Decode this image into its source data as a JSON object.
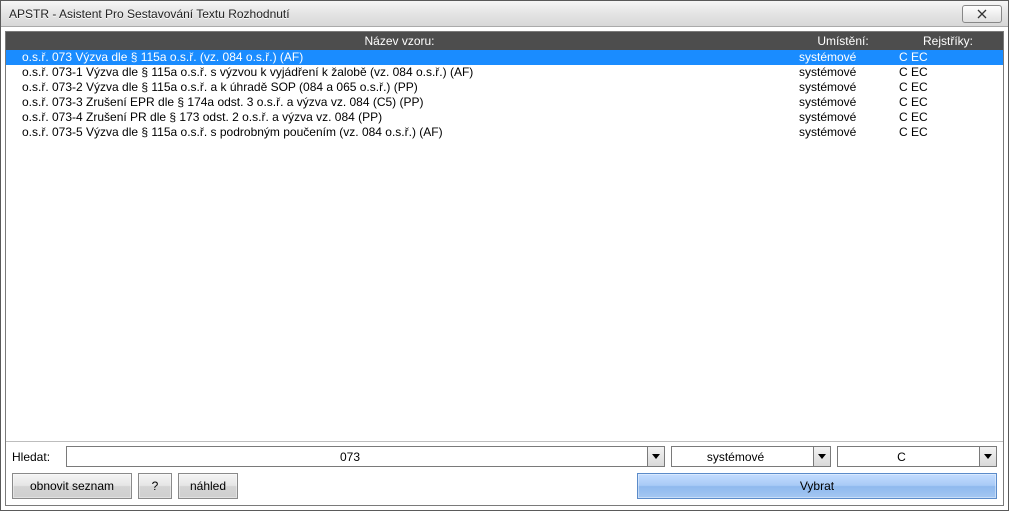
{
  "window": {
    "title": "APSTR - Asistent Pro Sestavování Textu Rozhodnutí"
  },
  "columns": {
    "name": "Název vzoru:",
    "location": "Umístění:",
    "registry": "Rejstříky:"
  },
  "rows": [
    {
      "name": "o.s.ř. 073 Výzva dle § 115a o.s.ř. (vz. 084 o.s.ř.) (AF)",
      "location": "systémové",
      "registry": "C EC",
      "selected": true
    },
    {
      "name": "o.s.ř. 073-1 Výzva dle § 115a o.s.ř. s výzvou k vyjádření k žalobě (vz. 084 o.s.ř.) (AF)",
      "location": "systémové",
      "registry": "C EC",
      "selected": false
    },
    {
      "name": "o.s.ř. 073-2 Výzva dle § 115a o.s.ř. a k úhradě SOP (084 a 065 o.s.ř.) (PP)",
      "location": "systémové",
      "registry": "C EC",
      "selected": false
    },
    {
      "name": "o.s.ř. 073-3 Zrušení EPR dle § 174a odst. 3 o.s.ř. a výzva vz. 084 (C5) (PP)",
      "location": "systémové",
      "registry": "C EC",
      "selected": false
    },
    {
      "name": "o.s.ř. 073-4 Zrušení PR dle § 173 odst. 2 o.s.ř. a výzva vz. 084 (PP)",
      "location": "systémové",
      "registry": "C EC",
      "selected": false
    },
    {
      "name": "o.s.ř. 073-5 Výzva dle § 115a o.s.ř. s podrobným poučením (vz. 084 o.s.ř.) (AF)",
      "location": "systémové",
      "registry": "C EC",
      "selected": false
    }
  ],
  "search": {
    "label": "Hledat:",
    "query": "073",
    "location": "systémové",
    "registry": "C"
  },
  "buttons": {
    "refresh": "obnovit seznam",
    "help": "?",
    "preview": "náhled",
    "select": "Vybrat"
  }
}
